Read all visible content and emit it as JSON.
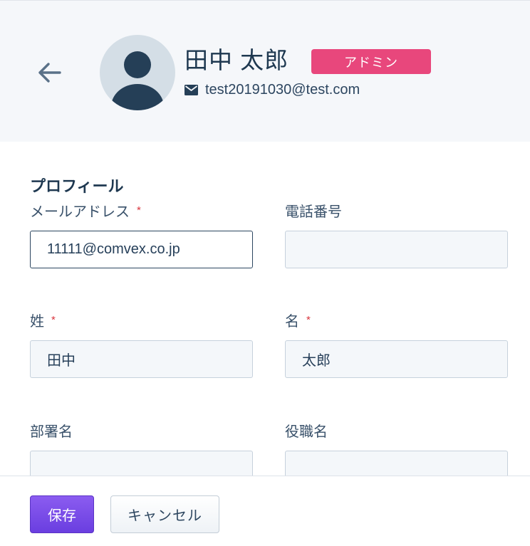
{
  "header": {
    "back_icon": "arrow-left-icon",
    "avatar_icon": "user-silhouette-icon",
    "user_name": "田中 太郎",
    "role_badge": "アドミン",
    "mail_icon": "envelope-icon",
    "email": "test20191030@test.com"
  },
  "profile": {
    "section_title": "プロフィール",
    "required_mark": "*",
    "fields": {
      "email": {
        "label": "メールアドレス",
        "value": "11111@comvex.co.jp",
        "required": true
      },
      "phone": {
        "label": "電話番号",
        "value": "",
        "required": false
      },
      "last_name": {
        "label": "姓",
        "value": "田中",
        "required": true
      },
      "first_name": {
        "label": "名",
        "value": "太郎",
        "required": true
      },
      "department": {
        "label": "部署名",
        "value": "",
        "required": false
      },
      "job_title": {
        "label": "役職名",
        "value": "",
        "required": false
      }
    }
  },
  "footer": {
    "save_label": "保存",
    "cancel_label": "キャンセル"
  },
  "colors": {
    "badge": "#e8477c",
    "save_button": "#7b4ee8",
    "required": "#d9363e",
    "header_bg": "#f5f7fa"
  }
}
